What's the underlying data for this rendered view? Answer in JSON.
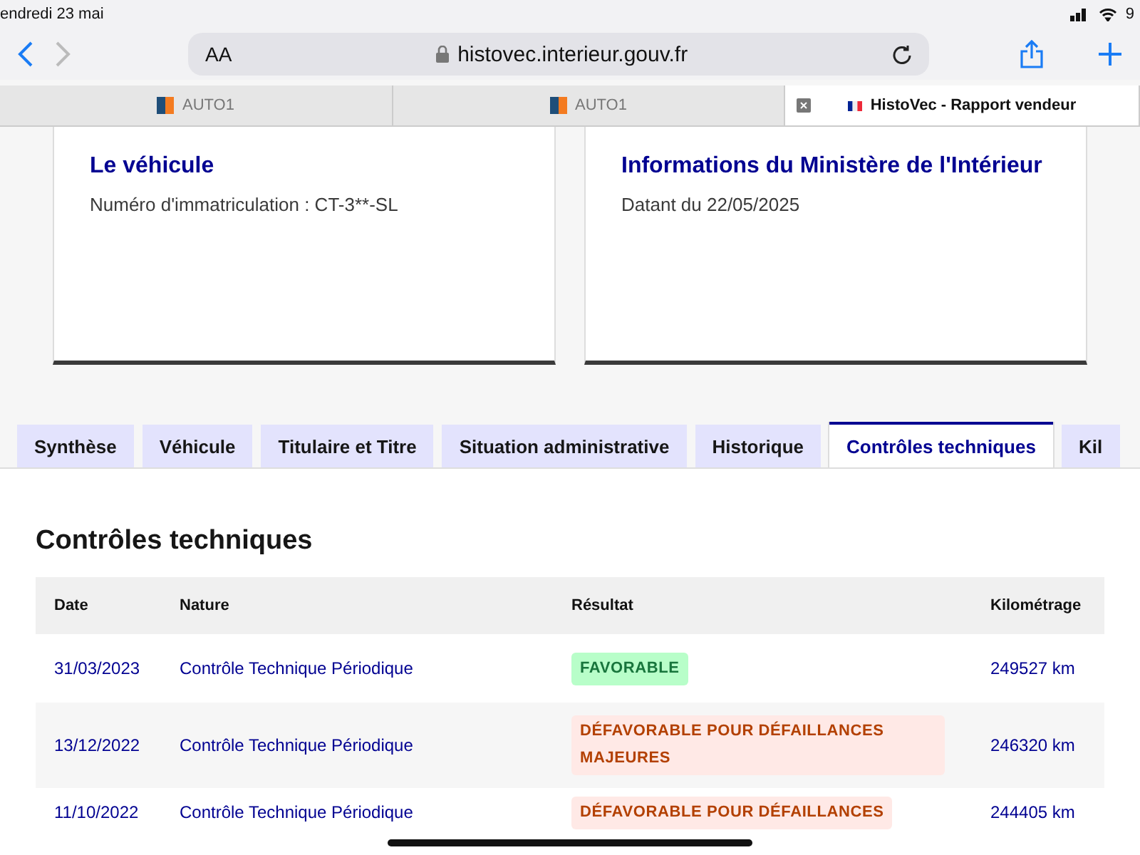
{
  "status_bar": {
    "date": "endredi 23 mai",
    "battery": "9"
  },
  "browser": {
    "text_size": "AA",
    "url": "histovec.interieur.gouv.fr"
  },
  "browser_tabs": [
    {
      "label": "AUTO1",
      "selected": false,
      "kind": "auto"
    },
    {
      "label": "AUTO1",
      "selected": false,
      "kind": "auto"
    },
    {
      "label": "HistoVec - Rapport vendeur",
      "selected": true,
      "kind": "flag"
    }
  ],
  "cards": [
    {
      "title": "Le véhicule",
      "text": "Numéro d'immatriculation : CT-3**-SL"
    },
    {
      "title": "Informations du Ministère de l'Intérieur",
      "text": "Datant du 22/05/2025"
    }
  ],
  "tabs": [
    {
      "label": "Synthèse",
      "selected": false
    },
    {
      "label": "Véhicule",
      "selected": false
    },
    {
      "label": "Titulaire et Titre",
      "selected": false
    },
    {
      "label": "Situation administrative",
      "selected": false
    },
    {
      "label": "Historique",
      "selected": false
    },
    {
      "label": "Contrôles techniques",
      "selected": true
    },
    {
      "label": "Kil",
      "selected": false
    }
  ],
  "section": {
    "title": "Contrôles techniques"
  },
  "table": {
    "columns": [
      "Date",
      "Nature",
      "Résultat",
      "Kilométrage"
    ],
    "rows": [
      {
        "date": "31/03/2023",
        "nature": "Contrôle Technique Périodique",
        "result": "FAVORABLE",
        "kind": "ok",
        "km": "249527 km"
      },
      {
        "date": "13/12/2022",
        "nature": "Contrôle Technique Périodique",
        "result": "DÉFAVORABLE POUR DÉFAILLANCES MAJEURES",
        "kind": "ko",
        "km": "246320 km"
      },
      {
        "date": "11/10/2022",
        "nature": "Contrôle Technique Périodique",
        "result": "DÉFAVORABLE POUR DÉFAILLANCES",
        "kind": "ko",
        "km": "244405 km"
      }
    ]
  }
}
